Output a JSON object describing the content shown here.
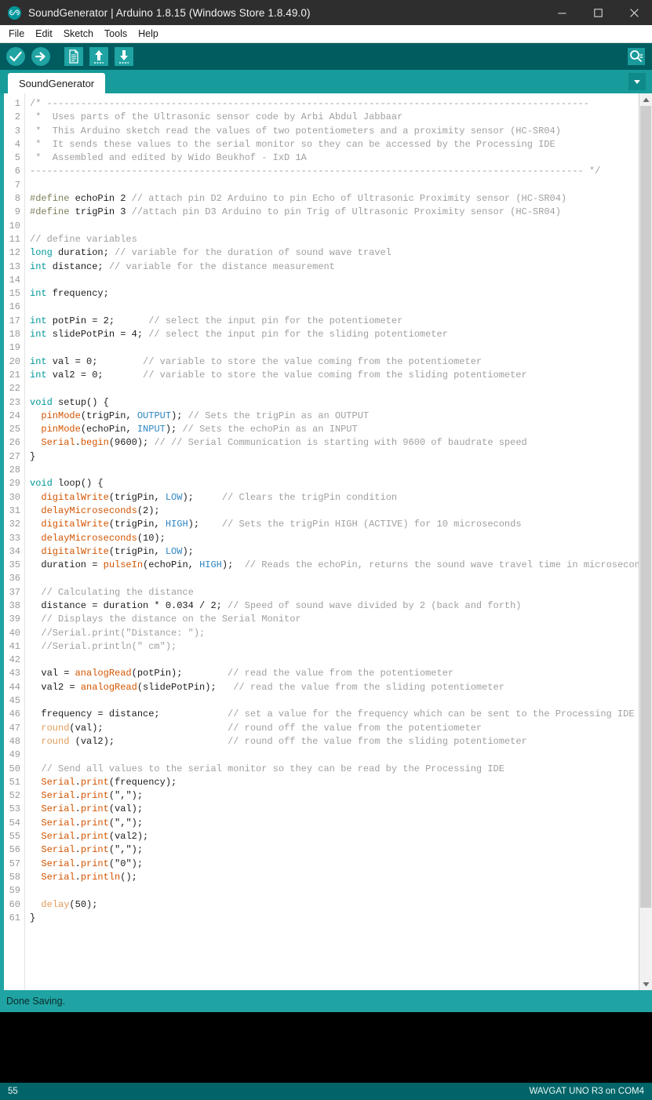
{
  "window": {
    "title": "SoundGenerator | Arduino 1.8.15 (Windows Store 1.8.49.0)",
    "logo_icon": "arduino-infinity-icon",
    "minimize_icon": "minimize-icon",
    "maximize_icon": "maximize-icon",
    "close_icon": "close-icon",
    "titlebar_color": "#2e2e2e"
  },
  "menubar": {
    "items": [
      {
        "label": "File"
      },
      {
        "label": "Edit"
      },
      {
        "label": "Sketch"
      },
      {
        "label": "Tools"
      },
      {
        "label": "Help"
      }
    ]
  },
  "toolbar": {
    "background": "#005c5f",
    "buttons": [
      {
        "name": "verify-button",
        "icon": "checkmark-circle-icon",
        "tooltip": "Verify"
      },
      {
        "name": "upload-button",
        "icon": "arrow-right-circle-icon",
        "tooltip": "Upload"
      },
      {
        "name": "new-button",
        "icon": "new-document-icon",
        "tooltip": "New"
      },
      {
        "name": "open-button",
        "icon": "arrow-up-icon",
        "tooltip": "Open"
      },
      {
        "name": "save-button",
        "icon": "arrow-down-icon",
        "tooltip": "Save"
      }
    ],
    "serial_monitor": {
      "name": "serial-monitor-button",
      "icon": "magnifier-icon",
      "tooltip": "Serial Monitor"
    }
  },
  "tabbar": {
    "background": "#179b9b",
    "tabs": [
      {
        "label": "SoundGenerator",
        "active": true
      }
    ],
    "menu_icon": "chevron-down-icon"
  },
  "editor": {
    "accent_color": "#1fa3a3",
    "scroll_up_icon": "chevron-up-icon",
    "scroll_down_icon": "chevron-down-icon",
    "lines": [
      {
        "n": 1,
        "tokens": [
          {
            "t": "/* ------------------------------------------------------------------------------------------------",
            "c": "cm"
          }
        ]
      },
      {
        "n": 2,
        "tokens": [
          {
            "t": " *  Uses parts of the Ultrasonic sensor code by Arbi Abdul Jabbaar",
            "c": "cm"
          }
        ]
      },
      {
        "n": 3,
        "tokens": [
          {
            "t": " *  This Arduino sketch read the values of two potentiometers and a proximity sensor (HC-SR04)",
            "c": "cm"
          }
        ]
      },
      {
        "n": 4,
        "tokens": [
          {
            "t": " *  It sends these values to the serial monitor so they can be accessed by the Processing IDE",
            "c": "cm"
          }
        ]
      },
      {
        "n": 5,
        "tokens": [
          {
            "t": " *  Assembled and edited by Wido Beukhof - IxD 1A",
            "c": "cm"
          }
        ]
      },
      {
        "n": 6,
        "tokens": [
          {
            "t": "-------------------------------------------------------------------------------------------------- */",
            "c": "cm"
          }
        ]
      },
      {
        "n": 7,
        "tokens": []
      },
      {
        "n": 8,
        "tokens": [
          {
            "t": "#define",
            "c": "pp"
          },
          {
            "t": " echoPin 2 ",
            "c": ""
          },
          {
            "t": "// attach pin D2 Arduino to pin Echo of Ultrasonic Proximity sensor (HC-SR04)",
            "c": "cm"
          }
        ]
      },
      {
        "n": 9,
        "tokens": [
          {
            "t": "#define",
            "c": "pp"
          },
          {
            "t": " trigPin 3 ",
            "c": ""
          },
          {
            "t": "//attach pin D3 Arduino to pin Trig of Ultrasonic Proximity sensor (HC-SR04)",
            "c": "cm"
          }
        ]
      },
      {
        "n": 10,
        "tokens": []
      },
      {
        "n": 11,
        "tokens": [
          {
            "t": "// define variables",
            "c": "cm"
          }
        ]
      },
      {
        "n": 12,
        "tokens": [
          {
            "t": "long",
            "c": "kw"
          },
          {
            "t": " duration; ",
            "c": ""
          },
          {
            "t": "// variable for the duration of sound wave travel",
            "c": "cm"
          }
        ]
      },
      {
        "n": 13,
        "tokens": [
          {
            "t": "int",
            "c": "kw"
          },
          {
            "t": " distance; ",
            "c": ""
          },
          {
            "t": "// variable for the distance measurement",
            "c": "cm"
          }
        ]
      },
      {
        "n": 14,
        "tokens": []
      },
      {
        "n": 15,
        "tokens": [
          {
            "t": "int",
            "c": "kw"
          },
          {
            "t": " frequency;",
            "c": ""
          }
        ]
      },
      {
        "n": 16,
        "tokens": []
      },
      {
        "n": 17,
        "tokens": [
          {
            "t": "int",
            "c": "kw"
          },
          {
            "t": " potPin = 2;      ",
            "c": ""
          },
          {
            "t": "// select the input pin for the potentiometer",
            "c": "cm"
          }
        ]
      },
      {
        "n": 18,
        "tokens": [
          {
            "t": "int",
            "c": "kw"
          },
          {
            "t": " slidePotPin = 4; ",
            "c": ""
          },
          {
            "t": "// select the input pin for the sliding potentiometer",
            "c": "cm"
          }
        ]
      },
      {
        "n": 19,
        "tokens": []
      },
      {
        "n": 20,
        "tokens": [
          {
            "t": "int",
            "c": "kw"
          },
          {
            "t": " val = 0;        ",
            "c": ""
          },
          {
            "t": "// variable to store the value coming from the potentiometer",
            "c": "cm"
          }
        ]
      },
      {
        "n": 21,
        "tokens": [
          {
            "t": "int",
            "c": "kw"
          },
          {
            "t": " val2 = 0;       ",
            "c": ""
          },
          {
            "t": "// variable to store the value coming from the sliding potentiometer",
            "c": "cm"
          }
        ]
      },
      {
        "n": 22,
        "tokens": []
      },
      {
        "n": 23,
        "tokens": [
          {
            "t": "void",
            "c": "kw"
          },
          {
            "t": " setup() {",
            "c": ""
          }
        ]
      },
      {
        "n": 24,
        "tokens": [
          {
            "t": "  ",
            "c": ""
          },
          {
            "t": "pinMode",
            "c": "fn"
          },
          {
            "t": "(trigPin, ",
            "c": ""
          },
          {
            "t": "OUTPUT",
            "c": "cst"
          },
          {
            "t": "); ",
            "c": ""
          },
          {
            "t": "// Sets the trigPin as an OUTPUT",
            "c": "cm"
          }
        ]
      },
      {
        "n": 25,
        "tokens": [
          {
            "t": "  ",
            "c": ""
          },
          {
            "t": "pinMode",
            "c": "fn"
          },
          {
            "t": "(echoPin, ",
            "c": ""
          },
          {
            "t": "INPUT",
            "c": "cst"
          },
          {
            "t": "); ",
            "c": ""
          },
          {
            "t": "// Sets the echoPin as an INPUT",
            "c": "cm"
          }
        ]
      },
      {
        "n": 26,
        "tokens": [
          {
            "t": "  ",
            "c": ""
          },
          {
            "t": "Serial",
            "c": "fn"
          },
          {
            "t": ".",
            "c": ""
          },
          {
            "t": "begin",
            "c": "fn"
          },
          {
            "t": "(9600); ",
            "c": ""
          },
          {
            "t": "// // Serial Communication is starting with 9600 of baudrate speed",
            "c": "cm"
          }
        ]
      },
      {
        "n": 27,
        "tokens": [
          {
            "t": "}",
            "c": ""
          }
        ]
      },
      {
        "n": 28,
        "tokens": []
      },
      {
        "n": 29,
        "tokens": [
          {
            "t": "void",
            "c": "kw"
          },
          {
            "t": " loop() {",
            "c": ""
          }
        ]
      },
      {
        "n": 30,
        "tokens": [
          {
            "t": "  ",
            "c": ""
          },
          {
            "t": "digitalWrite",
            "c": "fn"
          },
          {
            "t": "(trigPin, ",
            "c": ""
          },
          {
            "t": "LOW",
            "c": "cst"
          },
          {
            "t": ");     ",
            "c": ""
          },
          {
            "t": "// Clears the trigPin condition",
            "c": "cm"
          }
        ]
      },
      {
        "n": 31,
        "tokens": [
          {
            "t": "  ",
            "c": ""
          },
          {
            "t": "delayMicroseconds",
            "c": "fn"
          },
          {
            "t": "(2);",
            "c": ""
          }
        ]
      },
      {
        "n": 32,
        "tokens": [
          {
            "t": "  ",
            "c": ""
          },
          {
            "t": "digitalWrite",
            "c": "fn"
          },
          {
            "t": "(trigPin, ",
            "c": ""
          },
          {
            "t": "HIGH",
            "c": "cst"
          },
          {
            "t": ");    ",
            "c": ""
          },
          {
            "t": "// Sets the trigPin HIGH (ACTIVE) for 10 microseconds",
            "c": "cm"
          }
        ]
      },
      {
        "n": 33,
        "tokens": [
          {
            "t": "  ",
            "c": ""
          },
          {
            "t": "delayMicroseconds",
            "c": "fn"
          },
          {
            "t": "(10);",
            "c": ""
          }
        ]
      },
      {
        "n": 34,
        "tokens": [
          {
            "t": "  ",
            "c": ""
          },
          {
            "t": "digitalWrite",
            "c": "fn"
          },
          {
            "t": "(trigPin, ",
            "c": ""
          },
          {
            "t": "LOW",
            "c": "cst"
          },
          {
            "t": ");",
            "c": ""
          }
        ]
      },
      {
        "n": 35,
        "tokens": [
          {
            "t": "  duration = ",
            "c": ""
          },
          {
            "t": "pulseIn",
            "c": "fn"
          },
          {
            "t": "(echoPin, ",
            "c": ""
          },
          {
            "t": "HIGH",
            "c": "cst"
          },
          {
            "t": ");  ",
            "c": ""
          },
          {
            "t": "// Reads the echoPin, returns the sound wave travel time in microseconds",
            "c": "cm"
          }
        ]
      },
      {
        "n": 36,
        "tokens": []
      },
      {
        "n": 37,
        "tokens": [
          {
            "t": "  ",
            "c": ""
          },
          {
            "t": "// Calculating the distance",
            "c": "cm"
          }
        ]
      },
      {
        "n": 38,
        "tokens": [
          {
            "t": "  distance = duration * 0.034 / 2; ",
            "c": ""
          },
          {
            "t": "// Speed of sound wave divided by 2 (back and forth)",
            "c": "cm"
          }
        ]
      },
      {
        "n": 39,
        "tokens": [
          {
            "t": "  ",
            "c": ""
          },
          {
            "t": "// Displays the distance on the Serial Monitor",
            "c": "cm"
          }
        ]
      },
      {
        "n": 40,
        "tokens": [
          {
            "t": "  ",
            "c": ""
          },
          {
            "t": "//Serial.print(\"Distance: \");",
            "c": "cm"
          }
        ]
      },
      {
        "n": 41,
        "tokens": [
          {
            "t": "  ",
            "c": ""
          },
          {
            "t": "//Serial.println(\" cm\");",
            "c": "cm"
          }
        ]
      },
      {
        "n": 42,
        "tokens": []
      },
      {
        "n": 43,
        "tokens": [
          {
            "t": "  val = ",
            "c": ""
          },
          {
            "t": "analogRead",
            "c": "fn"
          },
          {
            "t": "(potPin);        ",
            "c": ""
          },
          {
            "t": "// read the value from the potentiometer",
            "c": "cm"
          }
        ]
      },
      {
        "n": 44,
        "tokens": [
          {
            "t": "  val2 = ",
            "c": ""
          },
          {
            "t": "analogRead",
            "c": "fn"
          },
          {
            "t": "(slidePotPin);   ",
            "c": ""
          },
          {
            "t": "// read the value from the sliding potentiometer",
            "c": "cm"
          }
        ]
      },
      {
        "n": 45,
        "tokens": []
      },
      {
        "n": 46,
        "tokens": [
          {
            "t": "  frequency = distance;            ",
            "c": ""
          },
          {
            "t": "// set a value for the frequency which can be sent to the Processing IDE",
            "c": "cm"
          }
        ]
      },
      {
        "n": 47,
        "tokens": [
          {
            "t": "  ",
            "c": ""
          },
          {
            "t": "round",
            "c": "fn2"
          },
          {
            "t": "(val);                      ",
            "c": ""
          },
          {
            "t": "// round off the value from the potentiometer",
            "c": "cm"
          }
        ]
      },
      {
        "n": 48,
        "tokens": [
          {
            "t": "  ",
            "c": ""
          },
          {
            "t": "round",
            "c": "fn2"
          },
          {
            "t": " (val2);                    ",
            "c": ""
          },
          {
            "t": "// round off the value from the sliding potentiometer",
            "c": "cm"
          }
        ]
      },
      {
        "n": 49,
        "tokens": []
      },
      {
        "n": 50,
        "tokens": [
          {
            "t": "  ",
            "c": ""
          },
          {
            "t": "// Send all values to the serial monitor so they can be read by the Processing IDE",
            "c": "cm"
          }
        ]
      },
      {
        "n": 51,
        "tokens": [
          {
            "t": "  ",
            "c": ""
          },
          {
            "t": "Serial",
            "c": "fn"
          },
          {
            "t": ".",
            "c": ""
          },
          {
            "t": "print",
            "c": "fn"
          },
          {
            "t": "(frequency);",
            "c": ""
          }
        ]
      },
      {
        "n": 52,
        "tokens": [
          {
            "t": "  ",
            "c": ""
          },
          {
            "t": "Serial",
            "c": "fn"
          },
          {
            "t": ".",
            "c": ""
          },
          {
            "t": "print",
            "c": "fn"
          },
          {
            "t": "(\",\");",
            "c": ""
          }
        ]
      },
      {
        "n": 53,
        "tokens": [
          {
            "t": "  ",
            "c": ""
          },
          {
            "t": "Serial",
            "c": "fn"
          },
          {
            "t": ".",
            "c": ""
          },
          {
            "t": "print",
            "c": "fn"
          },
          {
            "t": "(val);",
            "c": ""
          }
        ]
      },
      {
        "n": 54,
        "tokens": [
          {
            "t": "  ",
            "c": ""
          },
          {
            "t": "Serial",
            "c": "fn"
          },
          {
            "t": ".",
            "c": ""
          },
          {
            "t": "print",
            "c": "fn"
          },
          {
            "t": "(\",\");",
            "c": ""
          }
        ]
      },
      {
        "n": 55,
        "tokens": [
          {
            "t": "  ",
            "c": ""
          },
          {
            "t": "Serial",
            "c": "fn"
          },
          {
            "t": ".",
            "c": ""
          },
          {
            "t": "print",
            "c": "fn"
          },
          {
            "t": "(val2);",
            "c": ""
          }
        ]
      },
      {
        "n": 56,
        "tokens": [
          {
            "t": "  ",
            "c": ""
          },
          {
            "t": "Serial",
            "c": "fn"
          },
          {
            "t": ".",
            "c": ""
          },
          {
            "t": "print",
            "c": "fn"
          },
          {
            "t": "(\",\");",
            "c": ""
          }
        ]
      },
      {
        "n": 57,
        "tokens": [
          {
            "t": "  ",
            "c": ""
          },
          {
            "t": "Serial",
            "c": "fn"
          },
          {
            "t": ".",
            "c": ""
          },
          {
            "t": "print",
            "c": "fn"
          },
          {
            "t": "(\"0\");",
            "c": ""
          }
        ]
      },
      {
        "n": 58,
        "tokens": [
          {
            "t": "  ",
            "c": ""
          },
          {
            "t": "Serial",
            "c": "fn"
          },
          {
            "t": ".",
            "c": ""
          },
          {
            "t": "println",
            "c": "fn"
          },
          {
            "t": "();",
            "c": ""
          }
        ]
      },
      {
        "n": 59,
        "tokens": []
      },
      {
        "n": 60,
        "tokens": [
          {
            "t": "  ",
            "c": ""
          },
          {
            "t": "delay",
            "c": "fn2"
          },
          {
            "t": "(50);",
            "c": ""
          }
        ]
      },
      {
        "n": 61,
        "tokens": [
          {
            "t": "}",
            "c": ""
          }
        ]
      }
    ]
  },
  "status": {
    "message": "Done Saving.",
    "background": "#1fa3a3"
  },
  "console": {
    "text": "",
    "background": "#000000"
  },
  "bottombar": {
    "line_number": "55",
    "board_info": "WAVGAT UNO R3 on COM4",
    "background": "#006468"
  }
}
